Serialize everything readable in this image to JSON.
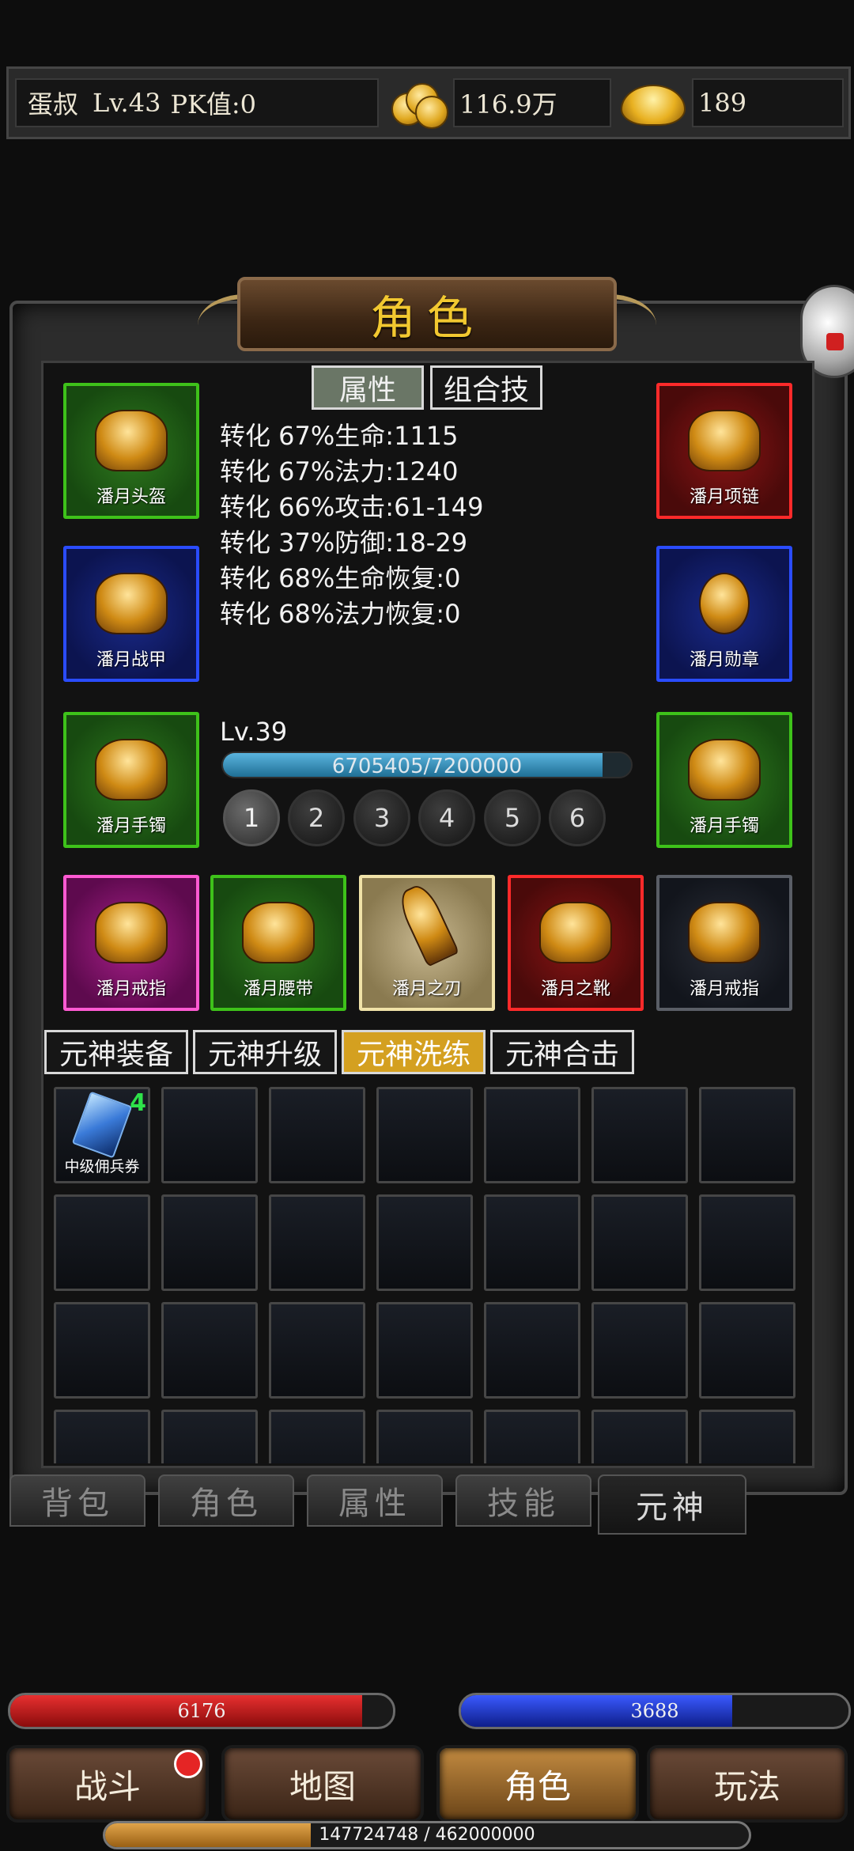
{
  "header": {
    "player_name": "蛋叔",
    "level": "Lv.43",
    "pk": "PK值:0",
    "gold": "116.9万",
    "ingot": "189",
    "gold_icon": "gold-coins-icon",
    "ingot_icon": "gold-ingot-icon"
  },
  "panel": {
    "title": "角色"
  },
  "subtabs": {
    "attributes": "属性",
    "combo": "组合技"
  },
  "equipment": {
    "helmet": "潘月头盔",
    "necklace": "潘月项链",
    "armor": "潘月战甲",
    "medal": "潘月勋章",
    "bracelet_left": "潘月手镯",
    "bracelet_right": "潘月手镯",
    "ring_left": "潘月戒指",
    "belt": "潘月腰带",
    "weapon": "潘月之刃",
    "boots": "潘月之靴",
    "ring_right": "潘月戒指"
  },
  "stats": [
    "转化 67%生命:1115",
    "转化 67%法力:1240",
    "转化 66%攻击:61-149",
    "转化 37%防御:18-29",
    "转化 68%生命恢复:0",
    "转化 68%法力恢复:0"
  ],
  "spirit": {
    "level": "Lv.39",
    "exp_text": "6705405/7200000",
    "exp_fraction": 0.931,
    "slots": [
      "1",
      "2",
      "3",
      "4",
      "5",
      "6"
    ],
    "active_slot": "1"
  },
  "spirit_tabs": [
    "元神装备",
    "元神升级",
    "元神洗练",
    "元神合击"
  ],
  "active_spirit_tab": "元神洗练",
  "inventory": {
    "item_name": "中级佣兵券",
    "item_count": "4",
    "item_icon": "mercenary-voucher-icon"
  },
  "bottom_tabs": [
    "背包",
    "角色",
    "属性",
    "技能",
    "元神"
  ],
  "active_bottom_tab": "元神",
  "hp": {
    "value": "6176",
    "fraction": 0.92
  },
  "mp": {
    "value": "3688",
    "fraction": 0.7
  },
  "nav": [
    "战斗",
    "地图",
    "角色",
    "玩法"
  ],
  "active_nav": "角色",
  "experience": {
    "text": "147724748 / 462000000",
    "fraction": 0.32
  },
  "colors": {
    "title_gold": "#f2c830",
    "hp_red": "#c41818",
    "mp_blue": "#2038d8",
    "active_tab_gold": "#d4a020"
  }
}
